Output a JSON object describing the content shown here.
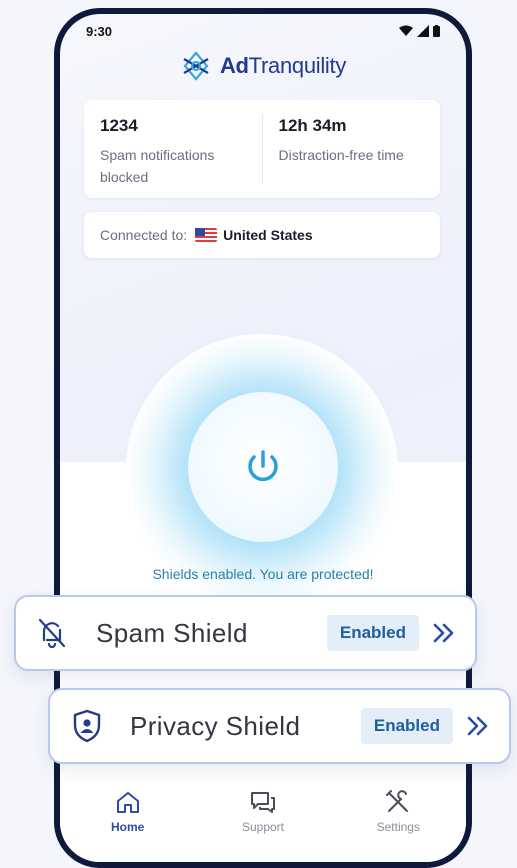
{
  "status_bar": {
    "time": "9:30"
  },
  "brand": {
    "name_bold": "Ad",
    "name_rest": "Tranquility",
    "color": "#243a8c"
  },
  "stats": [
    {
      "value": "1234",
      "label": "Spam notifications blocked"
    },
    {
      "value": "12h 34m",
      "label": "Distraction-free time"
    }
  ],
  "connection": {
    "label": "Connected to:",
    "country": "United States",
    "flag_icon": "us-flag-icon"
  },
  "protection": {
    "status_text": "Shields enabled. You are protected!",
    "power_icon": "power-icon",
    "accent": "#2a9fd8"
  },
  "shields": [
    {
      "name": "Spam Shield",
      "status": "Enabled",
      "icon": "bell-off-icon"
    },
    {
      "name": "Privacy Shield",
      "status": "Enabled",
      "icon": "shield-user-icon"
    }
  ],
  "nav": [
    {
      "label": "Home",
      "icon": "home-icon",
      "active": true
    },
    {
      "label": "Support",
      "icon": "chat-icon",
      "active": false
    },
    {
      "label": "Settings",
      "icon": "tools-icon",
      "active": false
    }
  ]
}
